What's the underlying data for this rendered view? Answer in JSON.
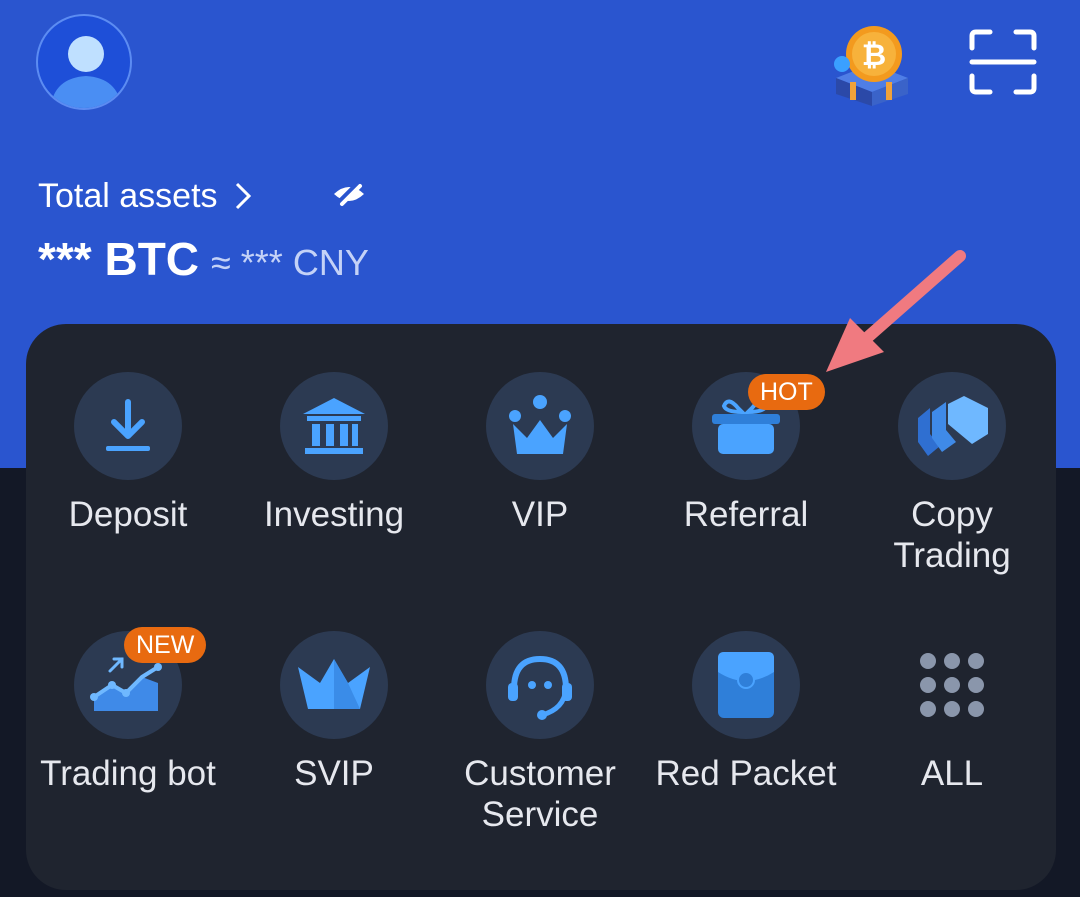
{
  "header": {
    "total_assets_label": "Total assets",
    "balance_btc": "*** BTC",
    "balance_cny": "≈ *** CNY",
    "colors": {
      "background": "#2a55cf",
      "panel": "#1f242f",
      "badge": "#e86a10",
      "icon": "#4aa3ff"
    }
  },
  "icons": {
    "avatar": "avatar-icon",
    "bonus": "bitcoin-bonus-icon",
    "scan": "scan-icon",
    "chevron": "chevron-right-icon",
    "visibility": "eye-off-icon"
  },
  "shortcuts": [
    {
      "label": "Deposit",
      "icon": "download-icon"
    },
    {
      "label": "Investing",
      "icon": "bank-icon"
    },
    {
      "label": "VIP",
      "icon": "crown-icon"
    },
    {
      "label": "Referral",
      "icon": "gift-icon",
      "badge": "HOT"
    },
    {
      "label": "Copy\nTrading",
      "icon": "copy-trading-icon"
    },
    {
      "label": "Trading bot",
      "icon": "trading-bot-icon",
      "badge": "NEW"
    },
    {
      "label": "SVIP",
      "icon": "svip-crown-icon"
    },
    {
      "label": "Customer\nService",
      "icon": "headset-icon"
    },
    {
      "label": "Red Packet",
      "icon": "red-packet-icon"
    },
    {
      "label": "ALL",
      "icon": "grid-icon"
    }
  ]
}
